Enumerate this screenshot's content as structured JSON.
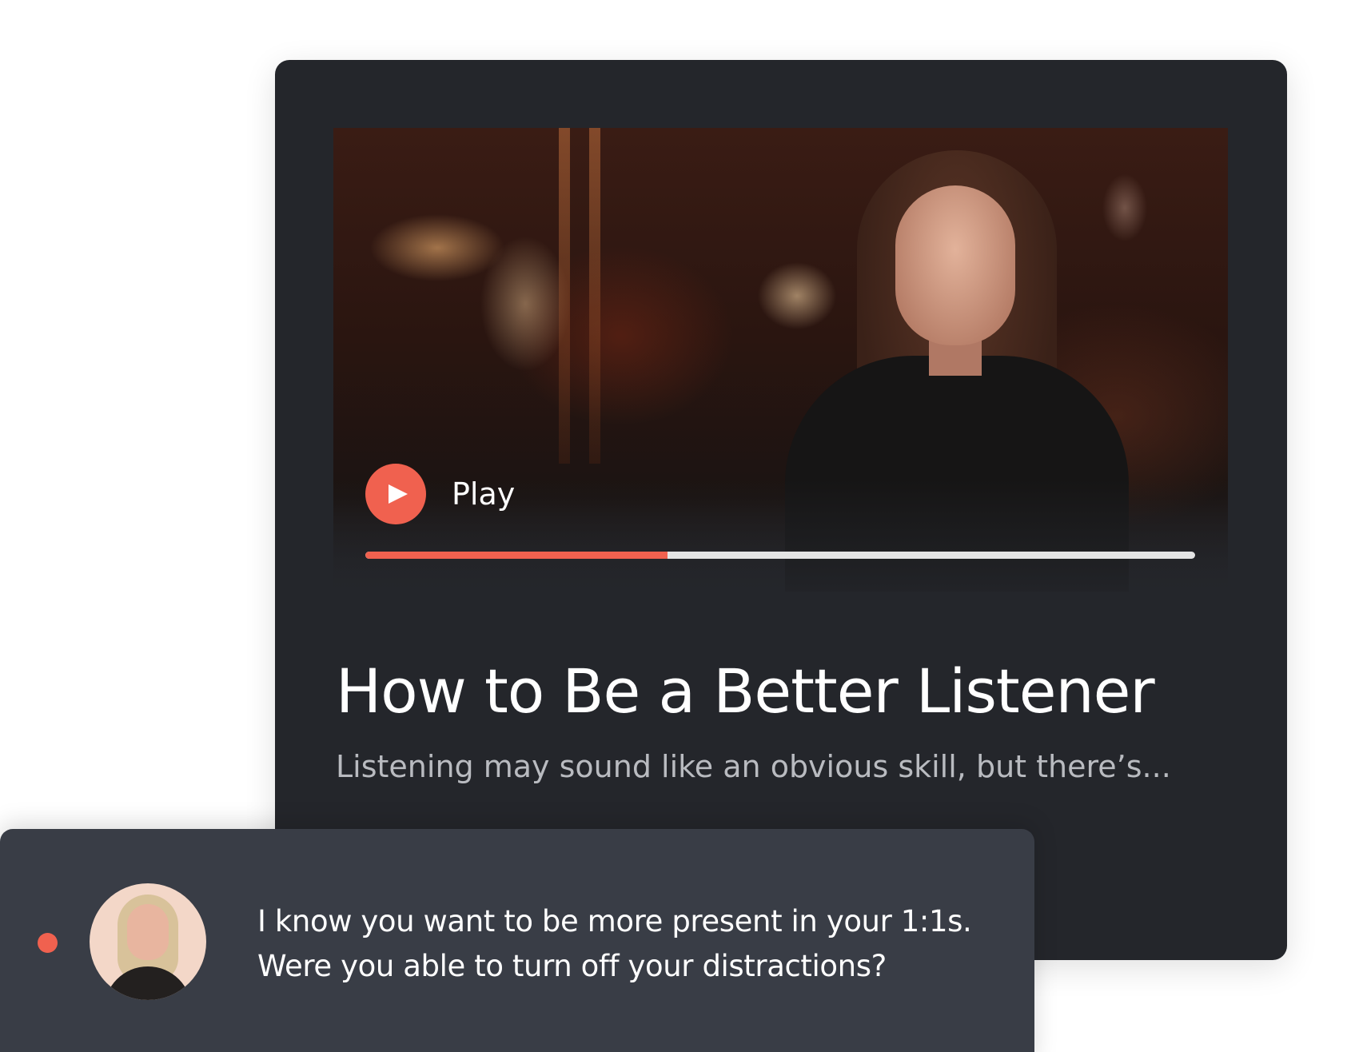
{
  "video": {
    "play_label": "Play",
    "progress_fraction": 0.364
  },
  "lesson": {
    "title": "How to Be a Better Listener",
    "subtitle": "Listening may sound like an obvious skill, but there’s..."
  },
  "message": {
    "line1": "I know you want to be more present in your 1:1s.",
    "line2": "Were you able to turn off your distractions?"
  },
  "icons": {
    "play": "play-icon",
    "status": "status-dot"
  },
  "colors": {
    "accent": "#f0614f",
    "card_background": "#24262b",
    "message_background": "#393d46",
    "subtitle_text": "#b9bbc0",
    "progress_track": "#e4e4e4"
  }
}
